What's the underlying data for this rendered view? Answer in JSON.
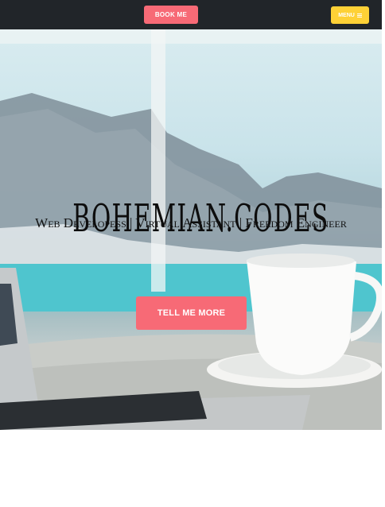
{
  "navbar": {
    "book_label": "BOOK ME",
    "menu_label": "MENU"
  },
  "hero": {
    "title": "BOHEMIAN.CODES",
    "subtitle": "Web Developess | Virtual Assistant | Freedom Engineer",
    "cta_label": "TELL ME MORE"
  },
  "colors": {
    "navbar_bg": "#212529",
    "primary_pink": "#f76a76",
    "menu_yellow": "#fed136"
  },
  "icons": {
    "menu": "hamburger-icon"
  }
}
